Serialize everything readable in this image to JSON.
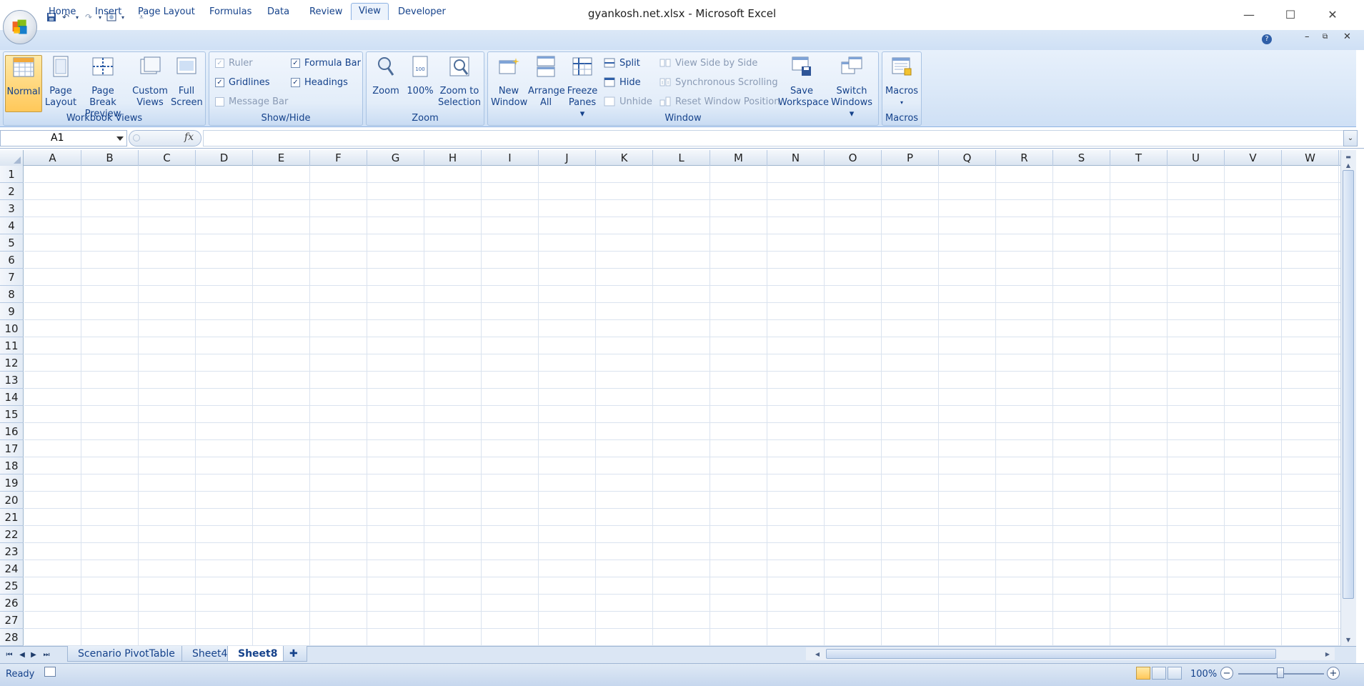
{
  "window": {
    "title": "gyankosh.net.xlsx - Microsoft Excel",
    "controls": [
      "minimize",
      "maximize",
      "close"
    ]
  },
  "ribbon_tabs": [
    "Home",
    "Insert",
    "Page Layout",
    "Formulas",
    "Data",
    "Review",
    "View",
    "Developer"
  ],
  "active_tab": "View",
  "groups": {
    "workbook_views": {
      "label": "Workbook Views",
      "buttons": [
        {
          "line1": "Normal",
          "line2": ""
        },
        {
          "line1": "Page",
          "line2": "Layout"
        },
        {
          "line1": "Page Break",
          "line2": "Preview"
        },
        {
          "line1": "Custom",
          "line2": "Views"
        },
        {
          "line1": "Full",
          "line2": "Screen"
        }
      ]
    },
    "show_hide": {
      "label": "Show/Hide",
      "items": [
        {
          "label": "Ruler",
          "checked": true,
          "disabled": true
        },
        {
          "label": "Gridlines",
          "checked": true,
          "disabled": false
        },
        {
          "label": "Message Bar",
          "checked": false,
          "disabled": true
        },
        {
          "label": "Formula Bar",
          "checked": true,
          "disabled": false
        },
        {
          "label": "Headings",
          "checked": true,
          "disabled": false
        }
      ]
    },
    "zoom": {
      "label": "Zoom",
      "buttons": [
        {
          "line1": "Zoom",
          "line2": ""
        },
        {
          "line1": "100%",
          "line2": ""
        },
        {
          "line1": "Zoom to",
          "line2": "Selection"
        }
      ]
    },
    "window": {
      "label": "Window",
      "buttons": [
        {
          "line1": "New",
          "line2": "Window"
        },
        {
          "line1": "Arrange",
          "line2": "All"
        },
        {
          "line1": "Freeze",
          "line2": "Panes ▾"
        }
      ],
      "small": [
        {
          "label": "Split",
          "disabled": false
        },
        {
          "label": "Hide",
          "disabled": false
        },
        {
          "label": "Unhide",
          "disabled": true
        },
        {
          "label": "View Side by Side",
          "disabled": true
        },
        {
          "label": "Synchronous Scrolling",
          "disabled": true
        },
        {
          "label": "Reset Window Position",
          "disabled": true
        }
      ],
      "buttons2": [
        {
          "line1": "Save",
          "line2": "Workspace"
        },
        {
          "line1": "Switch",
          "line2": "Windows ▾"
        }
      ]
    },
    "macros": {
      "label": "Macros",
      "buttons": [
        {
          "line1": "Macros",
          "line2": "▾"
        }
      ]
    }
  },
  "formula_bar": {
    "name_box": "A1",
    "fx": "fx",
    "formula": ""
  },
  "columns": [
    "A",
    "B",
    "C",
    "D",
    "E",
    "F",
    "G",
    "H",
    "I",
    "J",
    "K",
    "L",
    "M",
    "N",
    "O",
    "P",
    "Q",
    "R",
    "S",
    "T",
    "U",
    "V",
    "W"
  ],
  "rows": [
    "1",
    "2",
    "3",
    "4",
    "5",
    "6",
    "7",
    "8",
    "9",
    "10",
    "11",
    "12",
    "13",
    "14",
    "15",
    "16",
    "17",
    "18",
    "19",
    "20",
    "21",
    "22",
    "23",
    "24",
    "25",
    "26",
    "27",
    "28"
  ],
  "sheets": [
    "Scenario PivotTable",
    "Sheet4",
    "Sheet8"
  ],
  "active_sheet": "Sheet8",
  "status": {
    "text": "Ready",
    "zoom": "100%"
  },
  "colors": {
    "ribbon_text": "#15428b",
    "ribbon_bg": "#dce9f8",
    "active_button": "#ffc85a"
  }
}
